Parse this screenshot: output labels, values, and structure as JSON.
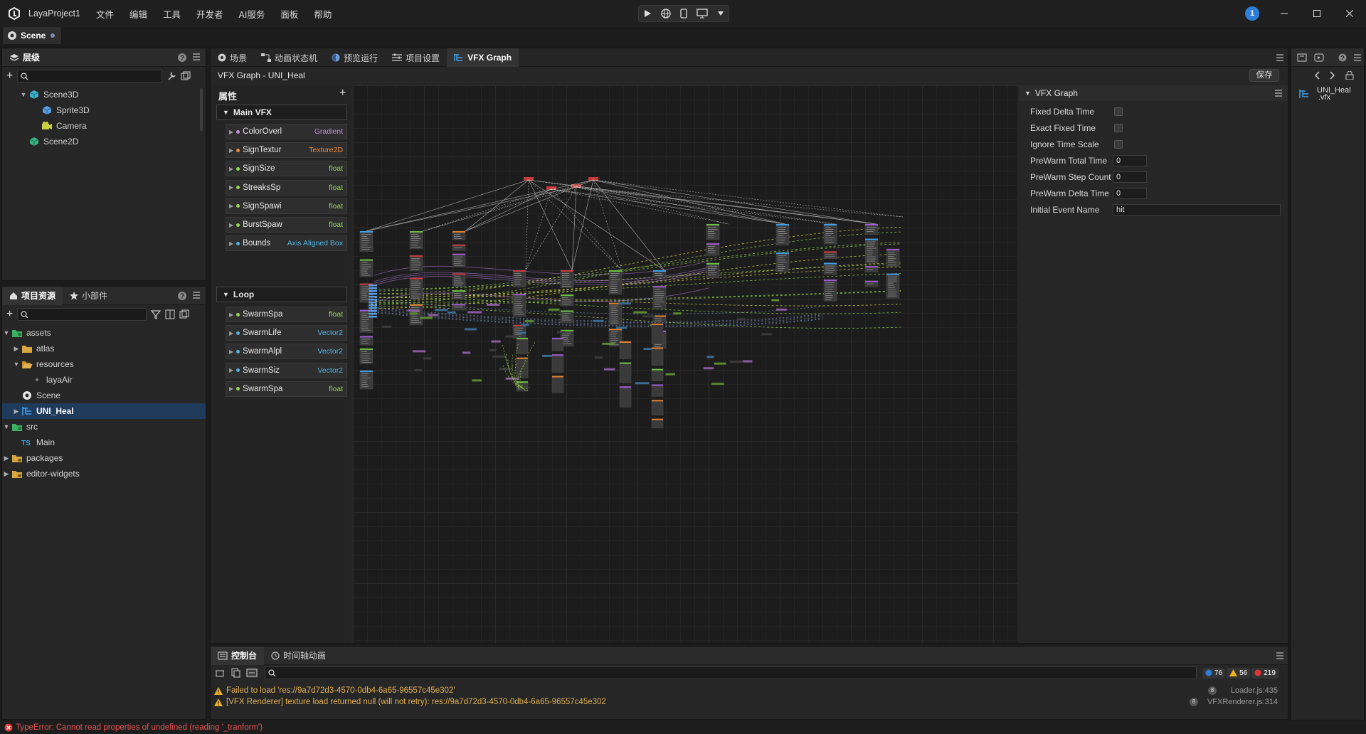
{
  "app": {
    "name": "LayaProject1",
    "notif_count": "1"
  },
  "menu": [
    "文件",
    "编辑",
    "工具",
    "开发者",
    "AI服务",
    "面板",
    "帮助"
  ],
  "scene_tab": "Scene",
  "hierarchy": {
    "title": "层级",
    "items": [
      {
        "label": "Scene3D",
        "indent": 0,
        "icon": "scene3d-icon",
        "expand": "▼"
      },
      {
        "label": "Sprite3D",
        "indent": 1,
        "icon": "sprite3d-icon",
        "expand": ""
      },
      {
        "label": "Camera",
        "indent": 1,
        "icon": "camera-icon",
        "expand": ""
      },
      {
        "label": "Scene2D",
        "indent": 0,
        "icon": "scene2d-icon",
        "expand": ""
      }
    ]
  },
  "project": {
    "tab1": "项目资源",
    "tab2": "小部件",
    "tree": [
      {
        "label": "assets",
        "indent": 0,
        "expand": "▼",
        "icon": "folder-green-icon"
      },
      {
        "label": "atlas",
        "indent": 1,
        "expand": "▶",
        "icon": "folder-icon"
      },
      {
        "label": "resources",
        "indent": 1,
        "expand": "▼",
        "icon": "folder-open-icon"
      },
      {
        "label": "layaAir",
        "indent": 2,
        "expand": "",
        "icon": "file-icon"
      },
      {
        "label": "Scene",
        "indent": 1,
        "expand": "",
        "icon": "scene-file-icon"
      },
      {
        "label": "UNI_Heal",
        "indent": 1,
        "expand": "▶",
        "icon": "vfx-file-icon",
        "selected": true
      },
      {
        "label": "src",
        "indent": 0,
        "expand": "▼",
        "icon": "folder-green-icon"
      },
      {
        "label": "Main",
        "indent": 1,
        "expand": "",
        "icon": "ts-file-icon"
      },
      {
        "label": "packages",
        "indent": 0,
        "expand": "▶",
        "icon": "folder-lock-icon"
      },
      {
        "label": "editor-widgets",
        "indent": 0,
        "expand": "▶",
        "icon": "folder-lock-icon"
      }
    ]
  },
  "editor_tabs": [
    {
      "label": "场景",
      "icon": "scene-tab-icon"
    },
    {
      "label": "动画状态机",
      "icon": "state-machine-icon"
    },
    {
      "label": "预览运行",
      "icon": "preview-icon"
    },
    {
      "label": "项目设置",
      "icon": "settings-icon"
    },
    {
      "label": "VFX Graph",
      "icon": "vfx-icon",
      "active": true
    }
  ],
  "vfx": {
    "title": "VFX Graph - UNI_Heal",
    "save": "保存",
    "props_title": "属性",
    "main_section": "Main VFX",
    "loop_section": "Loop",
    "main_props": [
      {
        "name": "ColorOverl",
        "type": "Gradient",
        "type_color": "#c98ce0",
        "dot": "#c98ce0"
      },
      {
        "name": "SignTextur",
        "type": "Texture2D",
        "type_color": "#f08a3c",
        "dot": "#f08a3c"
      },
      {
        "name": "SignSize",
        "type": "float",
        "type_color": "#8fd94f",
        "dot": "#8fd94f"
      },
      {
        "name": "StreaksSp",
        "type": "float",
        "type_color": "#8fd94f",
        "dot": "#8fd94f"
      },
      {
        "name": "SignSpawi",
        "type": "float",
        "type_color": "#8fd94f",
        "dot": "#8fd94f"
      },
      {
        "name": "BurstSpaw",
        "type": "float",
        "type_color": "#8fd94f",
        "dot": "#8fd94f"
      },
      {
        "name": "Bounds",
        "type": "Axis Aligned Box",
        "type_color": "#4fb4e0",
        "dot": "#4fb4e0"
      }
    ],
    "loop_props": [
      {
        "name": "SwarmSpa",
        "type": "float",
        "type_color": "#8fd94f",
        "dot": "#8fd94f"
      },
      {
        "name": "SwarmLife",
        "type": "Vector2",
        "type_color": "#4fb4e0",
        "dot": "#4fb4e0"
      },
      {
        "name": "SwarmAlpl",
        "type": "Vector2",
        "type_color": "#4fb4e0",
        "dot": "#4fb4e0"
      },
      {
        "name": "SwarmSiz",
        "type": "Vector2",
        "type_color": "#4fb4e0",
        "dot": "#4fb4e0"
      },
      {
        "name": "SwarmSpa",
        "type": "float",
        "type_color": "#8fd94f",
        "dot": "#8fd94f"
      }
    ]
  },
  "inspector": {
    "title": "VFX Graph",
    "fixed_delta": "Fixed Delta Time",
    "exact_fixed": "Exact Fixed Time",
    "ignore_scale": "Ignore Time Scale",
    "prewarm_total": "PreWarm Total Time",
    "prewarm_total_val": "0",
    "prewarm_step": "PreWarm Step Count",
    "prewarm_step_val": "0",
    "prewarm_delta": "PreWarm Delta Time",
    "prewarm_delta_val": "0",
    "initial_event": "Initial Event Name",
    "initial_event_val": "hit"
  },
  "asset_preview": {
    "name": "UNI_Heal",
    "ext": ".vfx"
  },
  "console": {
    "tab1": "控制台",
    "tab2": "时间轴动画",
    "info_count": "76",
    "warn_count": "56",
    "error_count": "219",
    "logs": [
      {
        "text": "Failed to load 'res://9a7d72d3-4570-0db4-6a65-96557c45e302'",
        "count": "8",
        "source": "Loader.js:435"
      },
      {
        "text": "[VFX Renderer] texture load returned null (will not retry): res://9a7d72d3-4570-0db4-6a65-96557c45e302",
        "count": "8",
        "source": "VFXRenderer.js:314"
      }
    ]
  },
  "status": {
    "error": "TypeError: Cannot read properties of undefined (reading '_tranform')"
  }
}
